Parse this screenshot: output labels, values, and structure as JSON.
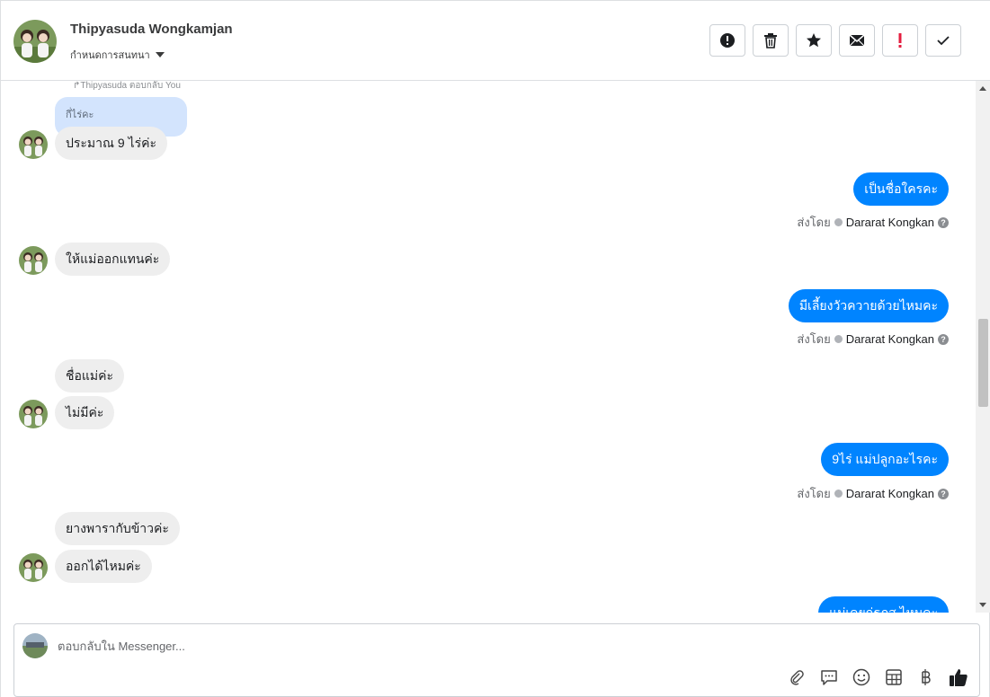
{
  "header": {
    "contact_name": "Thipyasuda Wongkamjan",
    "assign_label": "กำหนดการสนทนา",
    "actions": [
      {
        "name": "report-spam",
        "icon": "alert-circle-icon"
      },
      {
        "name": "delete",
        "icon": "trash-icon"
      },
      {
        "name": "star",
        "icon": "star-icon"
      },
      {
        "name": "mark-unread",
        "icon": "envelope-icon"
      },
      {
        "name": "mark-important",
        "icon": "exclamation-icon"
      },
      {
        "name": "mark-done",
        "icon": "check-icon"
      }
    ]
  },
  "conversation": {
    "reply_note": "Thipyasuda ตอบกลับ You",
    "quoted_text": "กี่ไร่คะ",
    "sent_by_prefix": "ส่งโดย",
    "agent_name": "Dararat Kongkan",
    "messages": [
      {
        "dir": "in",
        "text": "ประมาณ 9 ไร่ค่ะ"
      },
      {
        "dir": "out",
        "text": "เป็นชื่อใครคะ"
      },
      {
        "dir": "in",
        "text": "ให้แม่ออกแทนค่ะ"
      },
      {
        "dir": "out",
        "text": "มีเลี้ยงวัวควายด้วยไหมคะ"
      },
      {
        "dir": "in",
        "text": "ชื่อแม่ค่ะ"
      },
      {
        "dir": "in",
        "text": "ไม่มีค่ะ"
      },
      {
        "dir": "out",
        "text": "9ไร่ แม่ปลูกอะไรคะ"
      },
      {
        "dir": "in",
        "text": "ยางพารากับข้าวค่ะ"
      },
      {
        "dir": "in",
        "text": "ออกได้ไหมค่ะ"
      },
      {
        "dir": "out",
        "text": "แม่เคยกู่ธกส.ไหมคะ"
      }
    ]
  },
  "composer": {
    "placeholder": "ตอบกลับใน Messenger...",
    "icons": [
      "paperclip-icon",
      "comment-icon",
      "emoji-icon",
      "table-icon",
      "baht-icon",
      "thumbs-up-icon"
    ]
  },
  "colors": {
    "outgoing_bubble": "#0084ff",
    "incoming_bubble": "#eeeeee",
    "quoted_bubble": "#d3e4fd",
    "important_red": "#e41e3f"
  }
}
